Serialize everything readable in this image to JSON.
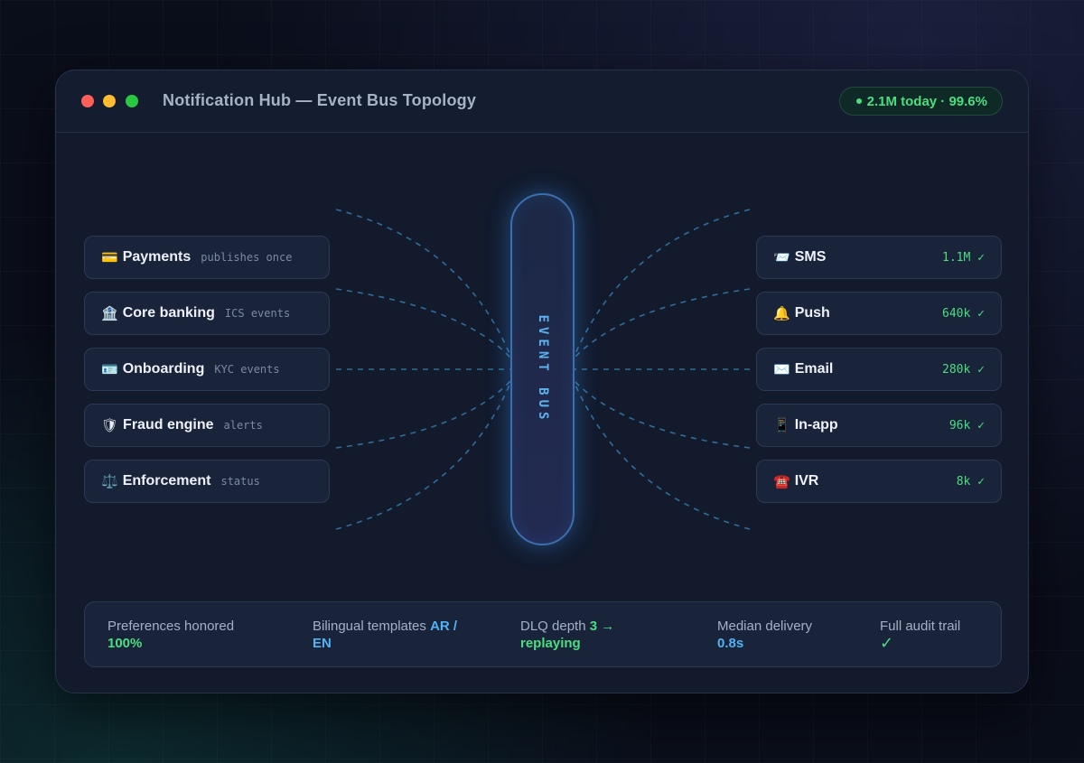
{
  "window": {
    "title": "Notification Hub — Event Bus Topology",
    "status": "2.1M today · 99.6%"
  },
  "bus": {
    "label": "EVENT BUS"
  },
  "sources": [
    {
      "icon": "💳",
      "icon_name": "credit-card-icon",
      "name": "Payments",
      "sub": "publishes once"
    },
    {
      "icon": "🏦",
      "icon_name": "bank-icon",
      "name": "Core banking",
      "sub": "ICS events"
    },
    {
      "icon": "🪪",
      "icon_name": "id-card-icon",
      "name": "Onboarding",
      "sub": "KYC events"
    },
    {
      "icon": "🛡",
      "icon_name": "shield-icon",
      "name": "Fraud engine",
      "sub": "alerts"
    },
    {
      "icon": "⚖️",
      "icon_name": "scales-icon",
      "name": "Enforcement",
      "sub": "status"
    }
  ],
  "channels": [
    {
      "icon": "📨",
      "icon_name": "envelope-icon",
      "name": "SMS",
      "count": "1.1M ✓"
    },
    {
      "icon": "🔔",
      "icon_name": "bell-icon",
      "name": "Push",
      "count": "640k ✓"
    },
    {
      "icon": "✉️",
      "icon_name": "mail-icon",
      "name": "Email",
      "count": "280k ✓"
    },
    {
      "icon": "📱",
      "icon_name": "phone-icon",
      "name": "In-app",
      "count": "96k ✓"
    },
    {
      "icon": "☎️",
      "icon_name": "telephone-icon",
      "name": "IVR",
      "count": "8k ✓"
    }
  ],
  "footer": {
    "preferences": {
      "label": "Preferences honored",
      "value": "100%"
    },
    "templates": {
      "label": "Bilingual templates",
      "value_1": "AR /",
      "value_2": "EN"
    },
    "dlq": {
      "label": "DLQ depth",
      "value_1": "3 →",
      "value_2": "replaying"
    },
    "median": {
      "label": "Median delivery",
      "value": "0.8s"
    },
    "audit": {
      "label": "Full audit trail",
      "value": "✓"
    }
  },
  "colors": {
    "accent_green": "#4ade80",
    "accent_blue": "#4fb3f5",
    "bus_border": "#3a6fb0"
  }
}
